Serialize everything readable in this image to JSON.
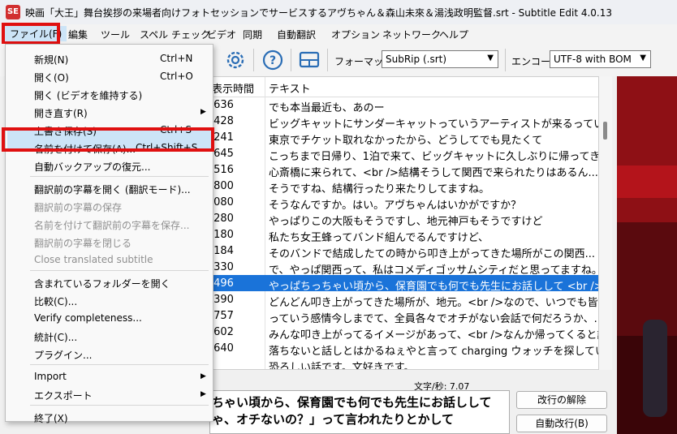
{
  "window": {
    "app_icon": "SE",
    "title": "映画「大王」舞台挨拶の来場者向けフォトセッションでサービスするアヴちゃん＆森山未來＆湯浅政明監督.srt - Subtitle Edit 4.0.13"
  },
  "menubar": {
    "items": [
      "ファイル(F)",
      "編集",
      "ツール",
      "スペル チェック",
      "ビデオ",
      "同期",
      "自動翻訳",
      "オプション",
      "ネットワーク",
      "ヘルプ"
    ]
  },
  "toolbar": {
    "format_label": "フォーマット",
    "format_value": "SubRip (.srt)",
    "encoding_label": "エンコード",
    "encoding_value": "UTF-8 with BOM",
    "icons": [
      "settings-icon",
      "help-icon",
      "layout-icon"
    ]
  },
  "grid": {
    "col_time": "表示時間",
    "col_text": "テキスト",
    "rows": [
      {
        "time": ".636",
        "text": "でも本当最近も、あのー"
      },
      {
        "time": ".428",
        "text": "ビッグキャットにサンダーキャットっていうアーティストが来るっていうので"
      },
      {
        "time": ".241",
        "text": "東京でチケット取れなかったから、どうしてでも見たくて"
      },
      {
        "time": ".645",
        "text": "こっちまで日帰り、1泊で来て、ビッグキャットに久しぶりに帰ってきま..."
      },
      {
        "time": ".516",
        "text": "心斎橋に来られて、<br />結構そうして関西で来られたりはあるん..."
      },
      {
        "time": ".800",
        "text": "そうですね、結構行ったり来たりしてますね。"
      },
      {
        "time": ".080",
        "text": "そうなんですか。はい。アヴちゃんはいかがですか？"
      },
      {
        "time": ".280",
        "text": "やっぱりこの大阪もそうですし、地元神戸もそうですけど"
      },
      {
        "time": ".180",
        "text": "私たち女王蜂ってバンド組んでるんですけど、"
      },
      {
        "time": ".184",
        "text": "そのバンドで結成したての時から叩き上がってきた場所がこの関西..."
      },
      {
        "time": ".330",
        "text": "で、やっぱ関西って、私はコメディゴッサムシティだと思ってますね。"
      },
      {
        "time": ".496",
        "text": "やっぱちっちゃい頃から、保育園でも何でも先生にお話しして <br />..."
      },
      {
        "time": ".390",
        "text": "どんどん叩き上がってきた場所が、地元。<br />なので、いつでも皆..."
      },
      {
        "time": ".757",
        "text": "っていう感情今しまでて、全員各々でオチがない会話で何だろうか、..."
      },
      {
        "time": ".602",
        "text": "みんな叩き上がってるイメージがあって、<br />なんか帰ってくると話..."
      },
      {
        "time": ".640",
        "text": "落ちないと話しとはかるねぇやと言って charging ウォッチを探していく..."
      },
      {
        "time": "",
        "text": "恐ろしい話です。文好きです。"
      }
    ]
  },
  "editor": {
    "cps_label": "文字/秒: 7.07",
    "line1": "ちゃい頃から、保育園でも何でも先生にお話しして",
    "line2": "ゃ、オチないの？」って言われたりとかして"
  },
  "buttons": {
    "unbreak": "改行の解除",
    "auto_break": "自動改行(B)"
  },
  "file_menu": {
    "items": [
      {
        "label": "新規(N)",
        "shortcut": "Ctrl+N",
        "disabled": false
      },
      {
        "label": "開く(O)",
        "shortcut": "Ctrl+O",
        "disabled": false
      },
      {
        "label": "開く (ビデオを維持する)",
        "shortcut": "",
        "disabled": false
      },
      {
        "label": "開き直す(R)",
        "shortcut": "",
        "disabled": false,
        "submenu": true
      },
      {
        "label": "上書き保存(S)",
        "shortcut": "Ctrl+S",
        "disabled": false
      },
      {
        "label": "名前を付けて保存(A)...",
        "shortcut": "Ctrl+Shift+S",
        "disabled": false,
        "highlighted": true
      },
      {
        "label": "自動バックアップの復元...",
        "shortcut": "",
        "disabled": false
      },
      {
        "label": "翻訳前の字幕を開く (翻訳モード)...",
        "shortcut": "",
        "disabled": false
      },
      {
        "label": "翻訳前の字幕の保存",
        "shortcut": "",
        "disabled": true
      },
      {
        "label": "名前を付けて翻訳前の字幕を保存...",
        "shortcut": "",
        "disabled": true
      },
      {
        "label": "翻訳前の字幕を閉じる",
        "shortcut": "",
        "disabled": true
      },
      {
        "label": "Close translated subtitle",
        "shortcut": "",
        "disabled": true
      },
      {
        "label": "含まれているフォルダーを開く",
        "shortcut": "",
        "disabled": false
      },
      {
        "label": "比較(C)...",
        "shortcut": "",
        "disabled": false
      },
      {
        "label": "Verify completeness...",
        "shortcut": "",
        "disabled": false
      },
      {
        "label": "統計(C)...",
        "shortcut": "",
        "disabled": false
      },
      {
        "label": "プラグイン...",
        "shortcut": "",
        "disabled": false
      },
      {
        "label": "Import",
        "shortcut": "",
        "disabled": false,
        "submenu": true
      },
      {
        "label": "エクスポート",
        "shortcut": "",
        "disabled": false,
        "submenu": true
      },
      {
        "label": "終了(X)",
        "shortcut": "",
        "disabled": false
      }
    ]
  },
  "colors": {
    "highlight_box": "#e01010",
    "selection": "#1a73d9",
    "menu_hover": "#cce4f7"
  }
}
